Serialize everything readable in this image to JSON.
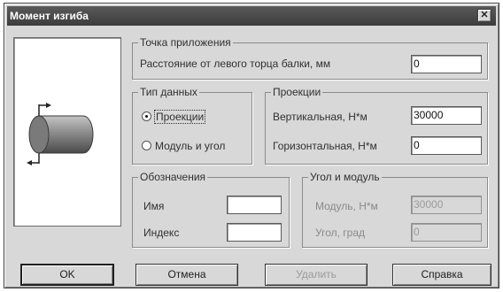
{
  "window": {
    "title": "Момент изгиба",
    "close_glyph": "✕"
  },
  "preview": {
    "icon": "beam-cylinder-icon"
  },
  "application_point": {
    "title": "Точка приложения",
    "distance_label": "Расстояние от левого торца балки, мм",
    "distance_value": "0"
  },
  "data_type": {
    "title": "Тип данных",
    "options": [
      {
        "label": "Проекции",
        "selected": true
      },
      {
        "label": "Модуль и угол",
        "selected": false
      }
    ]
  },
  "projections": {
    "title": "Проекции",
    "vertical_label": "Вертикальная, Н*м",
    "vertical_value": "30000",
    "horizontal_label": "Горизонтальная, Н*м",
    "horizontal_value": "0"
  },
  "designation": {
    "title": "Обозначения",
    "name_label": "Имя",
    "name_value": "",
    "index_label": "Индекс",
    "index_value": ""
  },
  "angle_modulus": {
    "title": "Угол и модуль",
    "modulus_label": "Модуль, Н*м",
    "modulus_value": "30000",
    "angle_label": "Угол, град",
    "angle_value": "0"
  },
  "buttons": {
    "ok": "OK",
    "cancel": "Отмена",
    "delete": "Удалить",
    "help": "Справка"
  },
  "colors": {
    "dialog_bg": "#d8d8d8",
    "titlebar": "#4a4a4a",
    "disabled_text": "#9a9a9a"
  }
}
